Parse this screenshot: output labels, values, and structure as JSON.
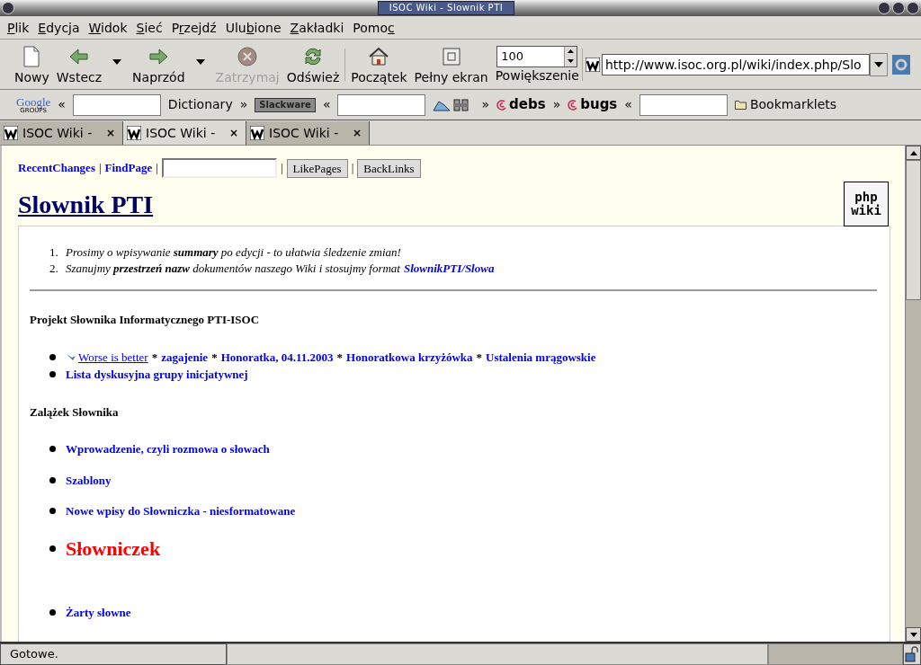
{
  "window": {
    "title": "ISOC Wiki - Slownik PTI"
  },
  "menu": [
    {
      "key": "P",
      "after": "lik"
    },
    {
      "key": "E",
      "after": "dycja"
    },
    {
      "key": "W",
      "after": "idok"
    },
    {
      "key": "S",
      "after": "ieć"
    },
    {
      "before": "P",
      "key": "r",
      "after": "zejdź"
    },
    {
      "before": "Ulu",
      "key": "b",
      "after": "ione"
    },
    {
      "key": "Z",
      "after": "akładki"
    },
    {
      "before": "Pomo",
      "key": "c"
    }
  ],
  "toolbar": [
    {
      "label": "Nowy",
      "dropdown": false,
      "disabled": false
    },
    {
      "label": "Wstecz",
      "dropdown": true,
      "disabled": false
    },
    {
      "label": "Naprzód",
      "dropdown": true,
      "disabled": false
    },
    {
      "label": "Zatrzymaj",
      "dropdown": false,
      "disabled": true
    },
    {
      "label": "Odśwież",
      "dropdown": false,
      "disabled": false
    },
    {
      "label": "Początek",
      "dropdown": false,
      "disabled": false
    },
    {
      "label": "Pełny ekran",
      "dropdown": false,
      "disabled": false
    }
  ],
  "zoom": {
    "value": "100",
    "label": "Powiększenie"
  },
  "address": {
    "value": "http://www.isoc.org.pl/wiki/index.php/Slo"
  },
  "bookmarks": [
    {
      "kind": "google",
      "text": "Google",
      "sub": "GROUPS"
    },
    {
      "kind": "text",
      "text": "«"
    },
    {
      "kind": "field"
    },
    {
      "kind": "text",
      "text": "Dictionary"
    },
    {
      "kind": "text",
      "text": "»"
    },
    {
      "kind": "badge",
      "text": "Slackware"
    },
    {
      "kind": "text",
      "text": "«"
    },
    {
      "kind": "field"
    },
    {
      "kind": "logo"
    },
    {
      "kind": "text",
      "text": "»"
    },
    {
      "kind": "debian",
      "text": "debs"
    },
    {
      "kind": "text",
      "text": "»"
    },
    {
      "kind": "debian",
      "text": "bugs"
    },
    {
      "kind": "text",
      "text": "«"
    },
    {
      "kind": "field"
    },
    {
      "kind": "folder",
      "text": "Bookmarklets"
    }
  ],
  "tabs": [
    {
      "label": "ISOC Wiki -",
      "close": "×",
      "selected": false
    },
    {
      "label": "ISOC Wiki -",
      "close": "×",
      "selected": true
    },
    {
      "label": "ISOC Wiki -",
      "close": "×",
      "selected": false
    }
  ],
  "page": {
    "nav_links": [
      "RecentChanges",
      "FindPage"
    ],
    "nav_separator": "|",
    "nav_buttons": [
      "LikePages",
      "BackLinks"
    ],
    "title": "Slownik PTI",
    "logo_text": [
      "php",
      "wiki"
    ],
    "notes": [
      {
        "number": "1.",
        "text": "Prosimy o wpisywanie **summary** po edycji - to ułatwia śledzenie zmian!"
      },
      {
        "number": "2.",
        "text": "Szanujmy **przestrzeń nazw** dokumentów naszego Wiki i stosujmy format",
        "link": "SlownikPTI/Slowa"
      }
    ],
    "sections": [
      {
        "heading": "Projekt Słownika Informatycznego PTI-ISOC",
        "spaced": false,
        "items": [
          {
            "segments": [
              {
                "kind": "external",
                "text": "Worse is better"
              },
              {
                "kind": "separator",
                "text": "*"
              },
              {
                "kind": "link",
                "text": "zagajenie"
              },
              {
                "kind": "separator",
                "text": "*"
              },
              {
                "kind": "link",
                "text": "Honoratka, 04.11.2003"
              },
              {
                "kind": "separator",
                "text": "*"
              },
              {
                "kind": "link",
                "text": "Honoratkowa krzyżówka"
              },
              {
                "kind": "separator",
                "text": "*"
              },
              {
                "kind": "link",
                "text": "Ustalenia mrągowskie"
              }
            ]
          },
          {
            "segments": [
              {
                "kind": "link",
                "text": "Lista dyskusyjna grupy inicjatywnej"
              }
            ]
          }
        ]
      },
      {
        "heading": "Zalążek Słownika",
        "spaced": true,
        "items": [
          {
            "segments": [
              {
                "kind": "link",
                "text": "Wprowadzenie, czyli rozmowa o słowach"
              }
            ]
          },
          {
            "segments": [
              {
                "kind": "link",
                "text": "Szablony"
              }
            ]
          },
          {
            "segments": [
              {
                "kind": "link",
                "text": "Nowe wpisy do Słowniczka - niesformatowane"
              }
            ]
          },
          {
            "segments": [
              {
                "kind": "featured",
                "text": "Słowniczek"
              }
            ]
          },
          {
            "segments": [
              {
                "kind": "link",
                "text": "Żarty słowne"
              }
            ]
          }
        ]
      }
    ]
  },
  "status": {
    "text": "Gotowe."
  }
}
